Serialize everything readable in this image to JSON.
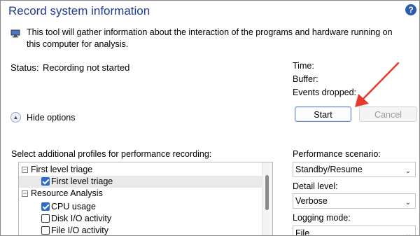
{
  "window": {
    "title": "Record system information",
    "help_icon": "?"
  },
  "info": {
    "icon": "info-icon",
    "text": "This tool will gather information about the interaction of the programs and hardware running on this computer for analysis."
  },
  "status": {
    "label": "Status:",
    "value": "Recording not started"
  },
  "meta": {
    "time_label": "Time:",
    "buffer_label": "Buffer:",
    "events_label": "Events dropped:"
  },
  "buttons": {
    "start": "Start",
    "cancel": "Cancel"
  },
  "options": {
    "toggle_label": "Hide options"
  },
  "profiles": {
    "label": "Select additional profiles for performance recording:",
    "groups": [
      {
        "name": "First level triage",
        "expanded": true,
        "items": [
          {
            "label": "First level triage",
            "checked": true,
            "selected": true
          }
        ]
      },
      {
        "name": "Resource Analysis",
        "expanded": true,
        "items": [
          {
            "label": "CPU usage",
            "checked": true
          },
          {
            "label": "Disk I/O activity",
            "checked": false
          },
          {
            "label": "File I/O activity",
            "checked": false
          }
        ]
      }
    ]
  },
  "scenario": {
    "label": "Performance scenario:",
    "value": "Standby/Resume"
  },
  "detail": {
    "label": "Detail level:",
    "value": "Verbose"
  },
  "logging": {
    "label": "Logging mode:",
    "value": "File"
  },
  "colors": {
    "title": "#1f3a93",
    "arrow": "#e53b2c",
    "checkbox": "#2b6ad0"
  }
}
